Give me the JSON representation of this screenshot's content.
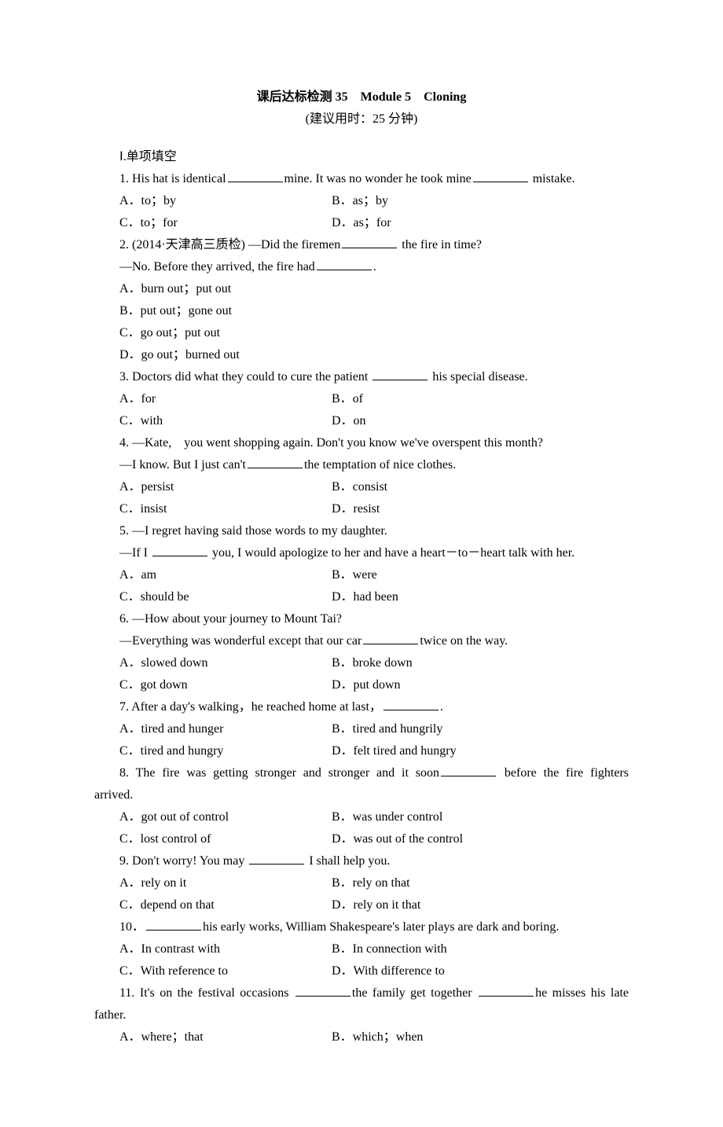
{
  "title": "课后达标检测 35　Module 5　Cloning",
  "subtitle": "(建议用时：25 分钟)",
  "section1": "Ⅰ.单项填空",
  "q1": {
    "text_a": "1. His hat is identical",
    "text_b": "mine. It was no wonder he took mine",
    "text_c": " mistake.",
    "a": "A．to；by",
    "b": "B．as；by",
    "c": "C．to；for",
    "d": "D．as；for"
  },
  "q2": {
    "text_a": "2. (2014·天津高三质检) —Did the firemen",
    "text_b": " the fire in time?",
    "text_c": "—No. Before they arrived, the fire had",
    "text_d": ".",
    "a": "A．burn out；put out",
    "b": "B．put out；gone out",
    "c": "C．go out；put out",
    "d": "D．go out；burned out"
  },
  "q3": {
    "text_a": "3. Doctors did what they could to cure the patient ",
    "text_b": " his special disease.",
    "a": "A．for",
    "b": "B．of",
    "c": "  C．with",
    "d": "D．on"
  },
  "q4": {
    "text_a": "4. —Kate,　you went shopping again. Don't you know we've overspent this month?",
    "text_b": "—I know. But I just can't",
    "text_c": "the temptation of nice clothes.",
    "a": "A．persist",
    "b": "B．consist",
    "c": "C．insist",
    "d": "D．resist"
  },
  "q5": {
    "text_a": "5. —I regret having said those words to my daughter.",
    "text_b": "—If I ",
    "text_c": " you, I would apologize to her and have a heart－to－heart talk with her.",
    "a": "A．am",
    "b": "B．were",
    "c": "C．should be",
    "d": "D．had been"
  },
  "q6": {
    "text_a": "6. —How about your journey to Mount Tai?",
    "text_b": "—Everything was wonderful except that our car",
    "text_c": "twice on the way.",
    "a": "A．slowed down",
    "b": "B．broke down",
    "c": "C．got down",
    "d": "D．put down"
  },
  "q7": {
    "text_a": "7. After a day's walking，he reached home at last，",
    "text_b": ".",
    "a": "A．tired and hunger",
    "b": "B．tired and hungrily",
    "c": "C．tired and hungry",
    "d": "D．felt tired and hungry"
  },
  "q8": {
    "text_a": "8. The fire was getting stronger and stronger and it soon",
    "text_b": " before the fire fighters",
    "text_c": "arrived.",
    "a": "A．got out of control",
    "b": "B．was under control",
    "c": "C．lost control of",
    "d": "D．was out of the control"
  },
  "q9": {
    "text_a": "9. Don't worry! You may ",
    "text_b": " I shall help you.",
    "a": "A．rely on it",
    "b": "B．rely on that",
    "c": "C．depend on that",
    "d": "D．rely on it that"
  },
  "q10": {
    "text_a": "10．",
    "text_b": "his early works, William Shakespeare's later plays are dark and boring.",
    "a": "A．In contrast with",
    "b": "B．In connection with",
    "c": "C．With reference to",
    "d": "D．With difference to"
  },
  "q11": {
    "text_a": "11. It's on the festival occasions ",
    "text_b": "the family get together ",
    "text_c": "he misses his late",
    "text_d": "father.",
    "a": "A．where；that",
    "b": "B．which；when"
  }
}
